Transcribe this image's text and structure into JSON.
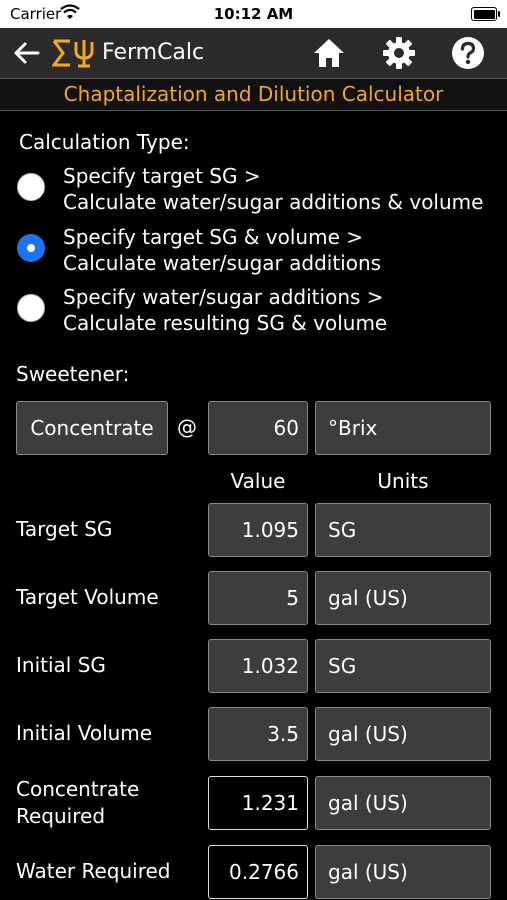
{
  "status": {
    "carrier": "Carrier",
    "time": "10:12 AM"
  },
  "nav": {
    "title": "FermCalc",
    "icons": [
      "back-arrow-icon",
      "fermcalc-logo-icon",
      "home-icon",
      "gear-icon",
      "help-icon"
    ]
  },
  "subtitle": "Chaptalization and Dilution Calculator",
  "calc_type": {
    "label": "Calculation Type:",
    "options": [
      {
        "line1": "Specify target SG  >",
        "line2": "Calculate water/sugar additions & volume",
        "selected": false
      },
      {
        "line1": "Specify target SG & volume  >",
        "line2": "Calculate water/sugar additions",
        "selected": true
      },
      {
        "line1": "Specify water/sugar additions  >",
        "line2": "Calculate resulting SG & volume",
        "selected": false
      }
    ]
  },
  "sweetener": {
    "label": "Sweetener:",
    "type": "Concentrate",
    "at": "@",
    "value": "60",
    "unit": "°Brix"
  },
  "columns": {
    "value": "Value",
    "units": "Units"
  },
  "rows": [
    {
      "label": "Target SG",
      "value": "1.095",
      "unit": "SG"
    },
    {
      "label": "Target Volume",
      "value": "5",
      "unit": "gal (US)"
    },
    {
      "label": "Initial SG",
      "value": "1.032",
      "unit": "SG"
    },
    {
      "label": "Initial Volume",
      "value": "3.5",
      "unit": "gal (US)"
    },
    {
      "label_line1": "Concentrate",
      "label_line2": "Required",
      "value": "1.231",
      "unit": "gal (US)"
    },
    {
      "label": "Water Required",
      "value": "0.2766",
      "unit": "gal (US)"
    }
  ],
  "colors": {
    "accent": "#f5a623",
    "radio_selected": "#1e74f0",
    "navbar": "#2b2b2b",
    "field": "#3d3d3d"
  }
}
